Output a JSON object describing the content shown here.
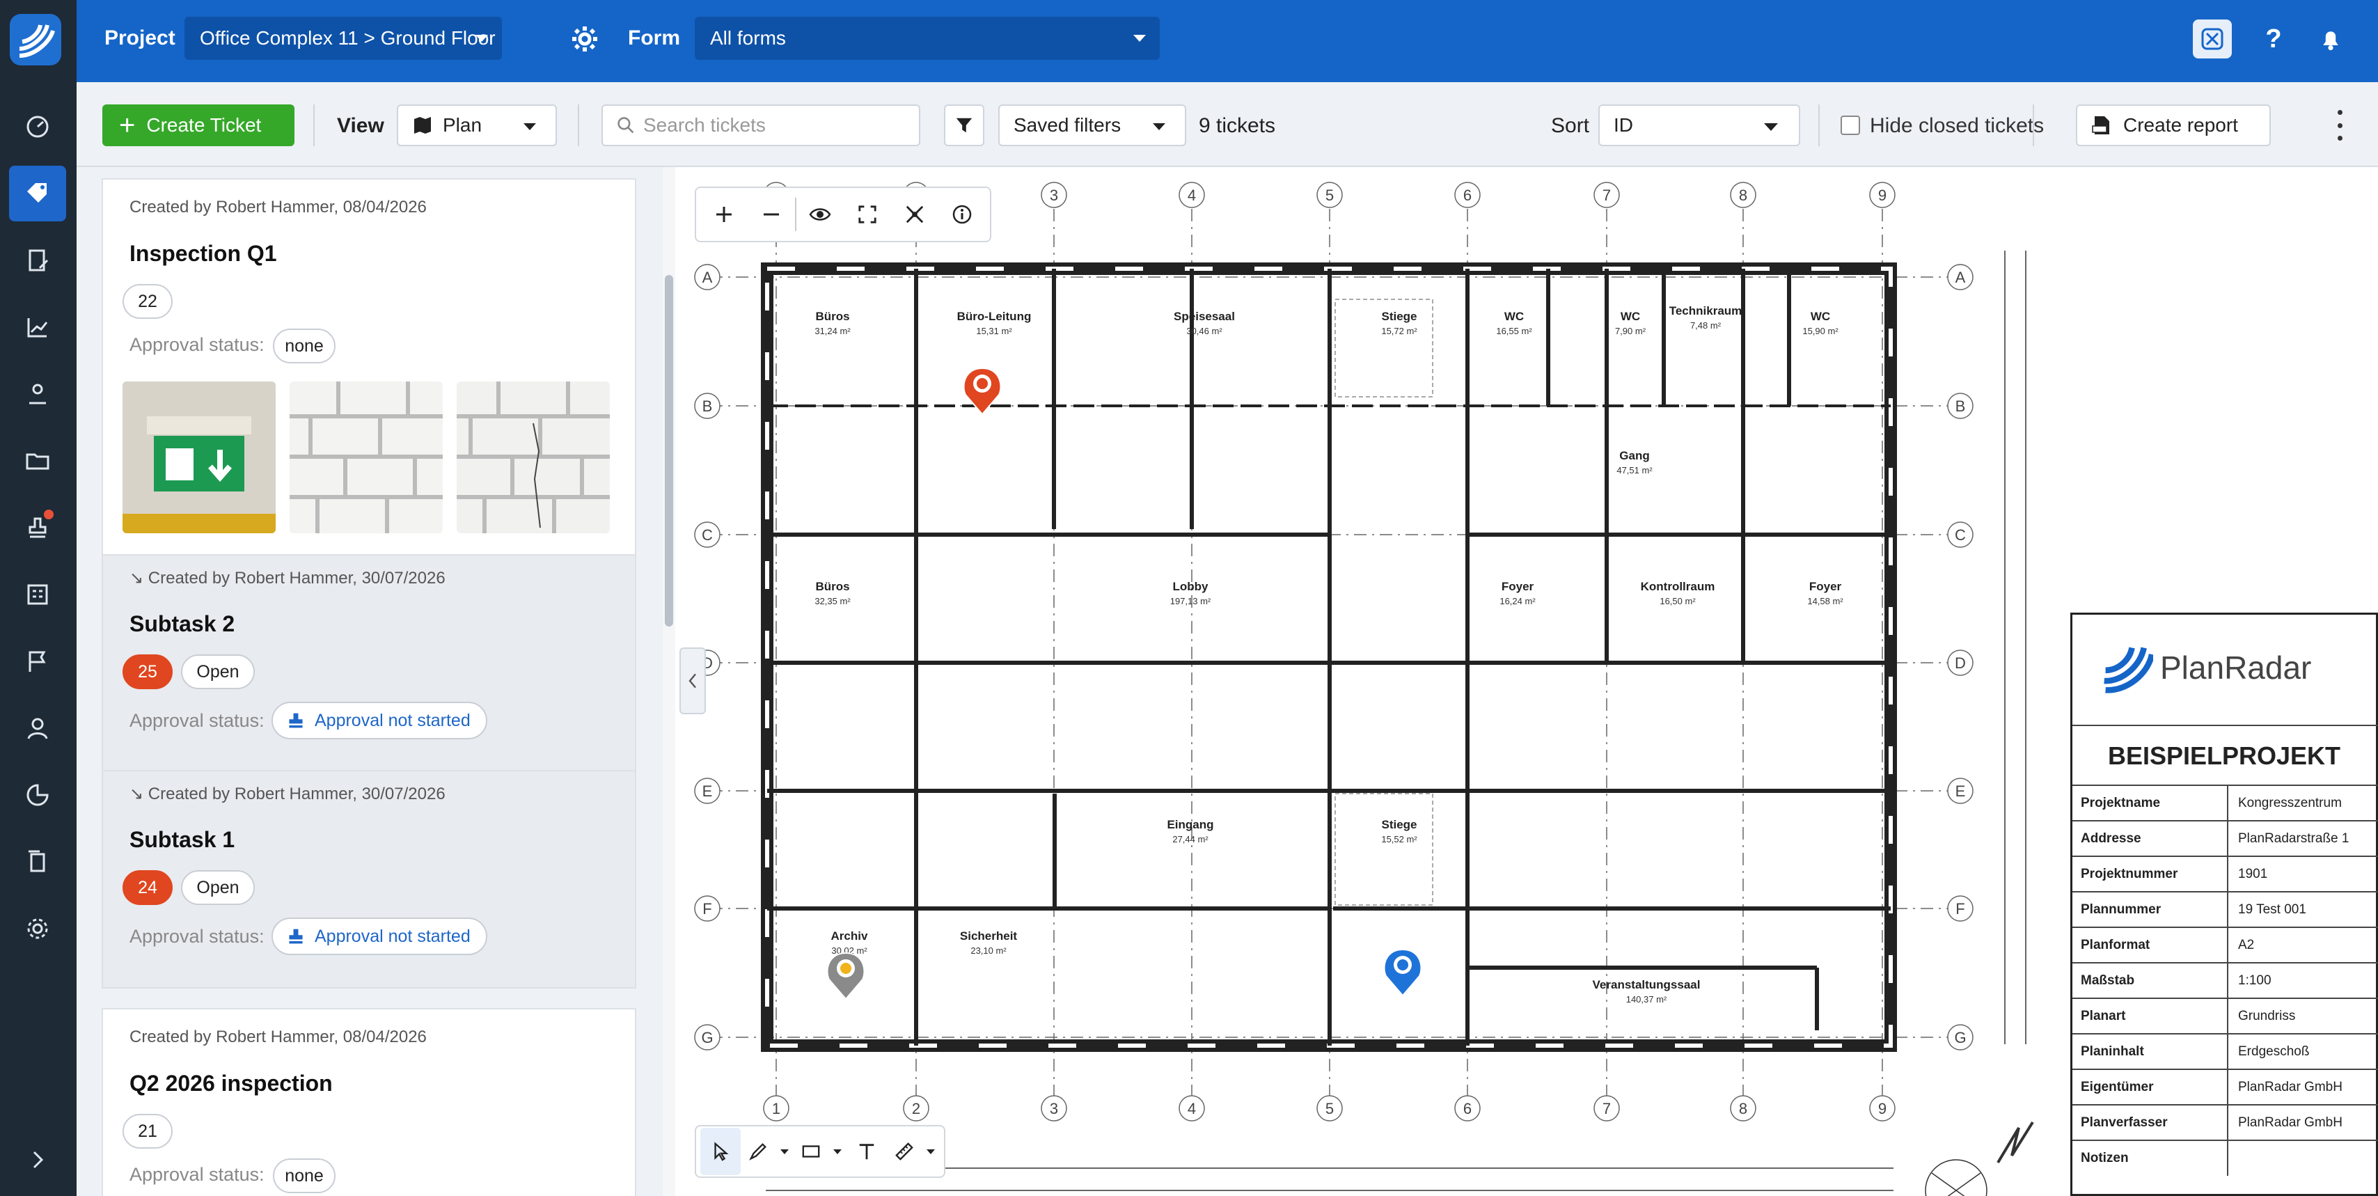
{
  "topbar": {
    "project_label": "Project",
    "project_value": "Office Complex 11 > Ground Floor",
    "form_label": "Form",
    "form_value": "All forms"
  },
  "toolbar": {
    "create_ticket": "Create Ticket",
    "view_label": "View",
    "view_value": "Plan",
    "search_placeholder": "Search tickets",
    "saved_filters": "Saved filters",
    "ticket_count": "9 tickets",
    "sort_label": "Sort",
    "sort_value": "ID",
    "hide_closed": "Hide closed tickets",
    "create_report": "Create report"
  },
  "tickets": [
    {
      "created": "Created by Robert Hammer, 08/04/2026",
      "title": "Inspection Q1",
      "id": "22",
      "approval_label": "Approval status:",
      "approval": "none"
    },
    {
      "created": "Created by Robert Hammer, 30/07/2026",
      "title": "Subtask 2",
      "id": "25",
      "status": "Open",
      "approval_label": "Approval status:",
      "approval": "Approval not started"
    },
    {
      "created": "Created by Robert Hammer, 30/07/2026",
      "title": "Subtask 1",
      "id": "24",
      "status": "Open",
      "approval_label": "Approval status:",
      "approval": "Approval not started"
    },
    {
      "created": "Created by Robert Hammer, 08/04/2026",
      "title": "Q2 2026 inspection",
      "id": "21",
      "approval_label": "Approval status:",
      "approval": "none"
    }
  ],
  "plan": {
    "rooms": [
      {
        "name": "Büros",
        "area": "31,24 m²"
      },
      {
        "name": "Büro-Leitung",
        "area": "15,31 m²"
      },
      {
        "name": "Speisesaal",
        "area": "30,46 m²"
      },
      {
        "name": "Stiege",
        "area": "15,72 m²"
      },
      {
        "name": "WC",
        "area": "16,55 m²"
      },
      {
        "name": "WC",
        "area": "7,90 m²"
      },
      {
        "name": "Technikraum",
        "area": "7,48 m²"
      },
      {
        "name": "WC",
        "area": "15,90 m²"
      },
      {
        "name": "Gang",
        "area": "47,51 m²"
      },
      {
        "name": "Büros",
        "area": "32,35 m²"
      },
      {
        "name": "Lobby",
        "area": "197,13 m²"
      },
      {
        "name": "Foyer",
        "area": "16,24 m²"
      },
      {
        "name": "Kontrollraum",
        "area": "16,50 m²"
      },
      {
        "name": "Foyer",
        "area": "14,58 m²"
      },
      {
        "name": "Eingang",
        "area": "27,44 m²"
      },
      {
        "name": "Stiege",
        "area": "15,52 m²"
      },
      {
        "name": "Archiv",
        "area": "30,02 m²"
      },
      {
        "name": "Sicherheit",
        "area": "23,10 m²"
      },
      {
        "name": "Veranstaltungssaal",
        "area": "140,37 m²"
      }
    ],
    "grid_cols": [
      "1",
      "2",
      "3",
      "4",
      "5",
      "6",
      "7",
      "8",
      "9"
    ],
    "grid_rows": [
      "A",
      "B",
      "C",
      "D",
      "E",
      "F",
      "G"
    ],
    "pin_colors": {
      "red": "#e0461f",
      "blue": "#1e73d8",
      "yellow": "#f2b21b"
    }
  },
  "titleblock": {
    "brand": "PlanRadar",
    "project_heading": "BEISPIELPROJEKT",
    "rows": [
      {
        "k": "Projektname",
        "v": "Kongresszentrum"
      },
      {
        "k": "Addresse",
        "v": "PlanRadarstraße 1"
      },
      {
        "k": "Projektnummer",
        "v": "1901"
      },
      {
        "k": "Plannummer",
        "v": "19 Test 001"
      },
      {
        "k": "Planformat",
        "v": "A2"
      },
      {
        "k": "Maßstab",
        "v": "1:100"
      },
      {
        "k": "Planart",
        "v": "Grundriss"
      },
      {
        "k": "Planinhalt",
        "v": "Erdgeschoß"
      },
      {
        "k": "Eigentümer",
        "v": "PlanRadar GmbH"
      },
      {
        "k": "Planverfasser",
        "v": "PlanRadar GmbH"
      },
      {
        "k": "Notizen",
        "v": ""
      }
    ]
  },
  "colors": {
    "brand_blue": "#1565c8",
    "green": "#35a829",
    "status_red": "#e0461f"
  }
}
